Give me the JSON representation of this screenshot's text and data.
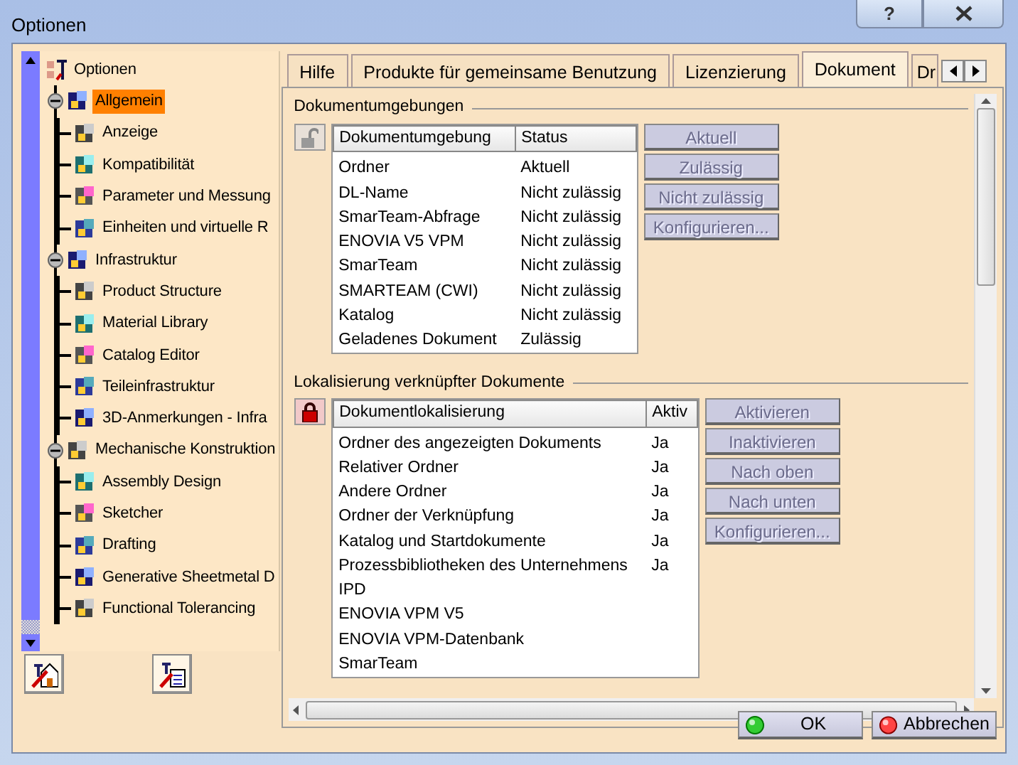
{
  "window": {
    "title": "Optionen",
    "help_button": "?"
  },
  "tree": [
    {
      "label": "Optionen",
      "selected": false,
      "children": [
        {
          "label": "Allgemein",
          "selected": true,
          "expanded": true,
          "children": [
            {
              "label": "Anzeige",
              "selected": false
            },
            {
              "label": "Kompatibilität",
              "selected": false
            },
            {
              "label": "Parameter und Messung",
              "selected": false
            },
            {
              "label": "Einheiten und virtuelle R",
              "selected": false
            }
          ]
        },
        {
          "label": "Infrastruktur",
          "selected": false,
          "expanded": true,
          "children": [
            {
              "label": "Product Structure",
              "selected": false
            },
            {
              "label": "Material Library",
              "selected": false
            },
            {
              "label": "Catalog Editor",
              "selected": false
            },
            {
              "label": "Teileinfrastruktur",
              "selected": false
            },
            {
              "label": "3D-Anmerkungen - Infra",
              "selected": false
            }
          ]
        },
        {
          "label": "Mechanische Konstruktion",
          "selected": false,
          "expanded": true,
          "children": [
            {
              "label": "Assembly Design",
              "selected": false
            },
            {
              "label": "Sketcher",
              "selected": false
            },
            {
              "label": "Drafting",
              "selected": false
            },
            {
              "label": "Generative Sheetmetal D",
              "selected": false
            },
            {
              "label": "Functional Tolerancing",
              "selected": false
            }
          ]
        }
      ]
    }
  ],
  "tabs": [
    {
      "label": "Hilfe",
      "selected": false
    },
    {
      "label": "Produkte für gemeinsame Benutzung",
      "selected": false
    },
    {
      "label": "Lizenzierung",
      "selected": false
    },
    {
      "label": "Dokument",
      "selected": true
    },
    {
      "label": "Dr",
      "selected": false
    }
  ],
  "sections": [
    {
      "title": "Dokumentumgebungen",
      "locked": false,
      "columns": [
        "Dokumentumgebung",
        "Status"
      ],
      "rows": [
        [
          "Ordner",
          "Aktuell"
        ],
        [
          "DL-Name",
          "Nicht zulässig"
        ],
        [
          "SmarTeam-Abfrage",
          "Nicht zulässig"
        ],
        [
          "ENOVIA V5 VPM",
          "Nicht zulässig"
        ],
        [
          "SmarTeam",
          "Nicht zulässig"
        ],
        [
          "SMARTEAM (CWI)",
          "Nicht zulässig"
        ],
        [
          "Katalog",
          "Nicht zulässig"
        ],
        [
          "Geladenes Dokument",
          "Zulässig"
        ]
      ],
      "buttons": [
        {
          "label": "Aktuell",
          "disabled": true
        },
        {
          "label": "Zulässig",
          "disabled": true
        },
        {
          "label": "Nicht zulässig",
          "disabled": true
        },
        {
          "label": "Konfigurieren...",
          "disabled": true
        }
      ]
    },
    {
      "title": "Lokalisierung verknüpfter Dokumente",
      "locked": true,
      "columns": [
        "Dokumentlokalisierung",
        "Aktiv"
      ],
      "rows": [
        [
          "Ordner des angezeigten Dokuments",
          "Ja"
        ],
        [
          "Relativer Ordner",
          "Ja"
        ],
        [
          "Andere Ordner",
          "Ja"
        ],
        [
          "Ordner der Verknüpfung",
          "Ja"
        ],
        [
          "Katalog und Startdokumente",
          "Ja"
        ],
        [
          "Prozessbibliotheken des Unternehmens",
          "Ja"
        ],
        [
          "IPD"
        ],
        [
          "ENOVIA VPM V5"
        ],
        [
          "ENOVIA VPM-Datenbank"
        ],
        [
          "SmarTeam"
        ]
      ],
      "buttons": [
        {
          "label": "Aktivieren",
          "disabled": true
        },
        {
          "label": "Inaktivieren",
          "disabled": true
        },
        {
          "label": "Nach oben",
          "disabled": true
        },
        {
          "label": "Nach unten",
          "disabled": true
        },
        {
          "label": "Konfigurieren...",
          "disabled": true
        }
      ]
    }
  ],
  "footer_buttons": [
    {
      "label": "OK",
      "kind": "ok"
    },
    {
      "label": "Abbrechen",
      "kind": "cancel"
    }
  ]
}
